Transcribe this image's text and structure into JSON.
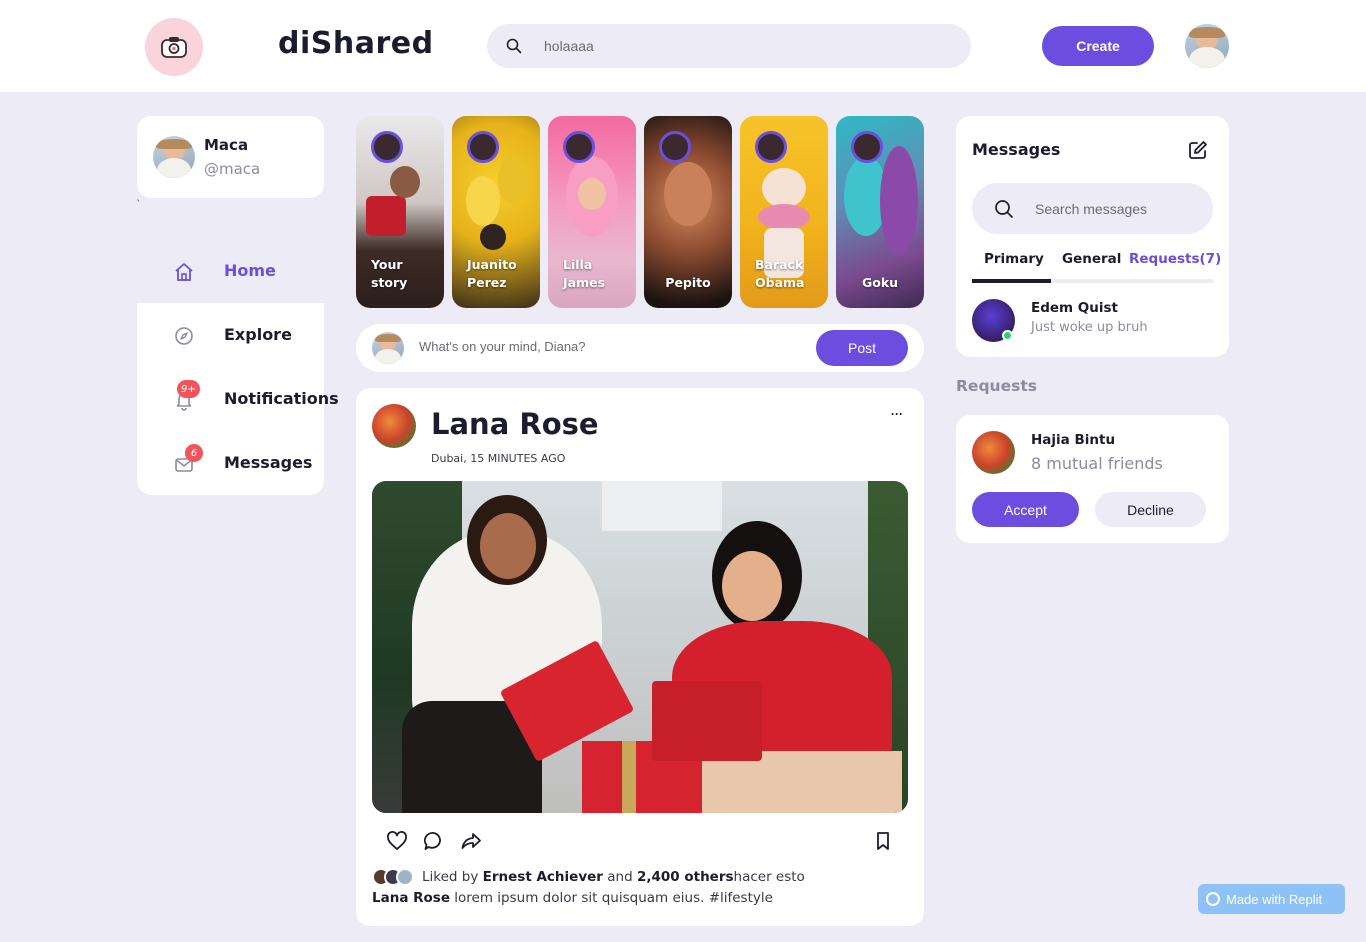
{
  "header": {
    "brand": "diShared",
    "search_value": "holaaaa",
    "create_label": "Create"
  },
  "profile": {
    "name": "Maca",
    "handle": "@maca",
    "stray_mark": "`"
  },
  "nav": {
    "items": [
      {
        "label": "Home",
        "icon": "home-icon",
        "active": true
      },
      {
        "label": "Explore",
        "icon": "compass-icon"
      },
      {
        "label": "Notifications",
        "icon": "bell-icon",
        "badge": "9+"
      },
      {
        "label": "Messages",
        "icon": "mail-icon",
        "badge": "6"
      }
    ]
  },
  "stories": [
    {
      "line1": "Your",
      "line2": "story"
    },
    {
      "line1": "Juanito",
      "line2": "Perez"
    },
    {
      "line1": "Lilla",
      "line2": "James"
    },
    {
      "line1": "",
      "line2": "Pepito"
    },
    {
      "line1": "Barack",
      "line2": "Obama"
    },
    {
      "line1": "",
      "line2": "Goku"
    }
  ],
  "composer": {
    "placeholder": "What's on your mind, Diana?",
    "post_label": "Post"
  },
  "feed": {
    "author": "Lana Rose",
    "meta": "Dubai, 15 MINUTES AGO",
    "more": "...",
    "liked_prefix": "Liked by",
    "liked_user": "Ernest Achiever",
    "liked_and": "and",
    "liked_others": "2,400 others",
    "liked_suffix": "hacer esto",
    "caption_author": "Lana Rose",
    "caption_text": "lorem ipsum dolor sit quisquam eius. #lifestyle"
  },
  "messages": {
    "title": "Messages",
    "search_placeholder": "Search messages",
    "tabs": [
      "Primary",
      "General",
      "Requests(7)"
    ],
    "rows": [
      {
        "name": "Edem Quist",
        "text": "Just woke up bruh",
        "online": true
      }
    ]
  },
  "requests": {
    "title": "Requests",
    "name": "Hajia Bintu",
    "mutual": "8 mutual friends",
    "accept": "Accept",
    "decline": "Decline"
  },
  "badge_replit": "Made with Replit",
  "colors": {
    "accent": "#6B4EE0",
    "background": "#ECEBF6",
    "badge": "#F2545B",
    "online": "#33D06A"
  }
}
